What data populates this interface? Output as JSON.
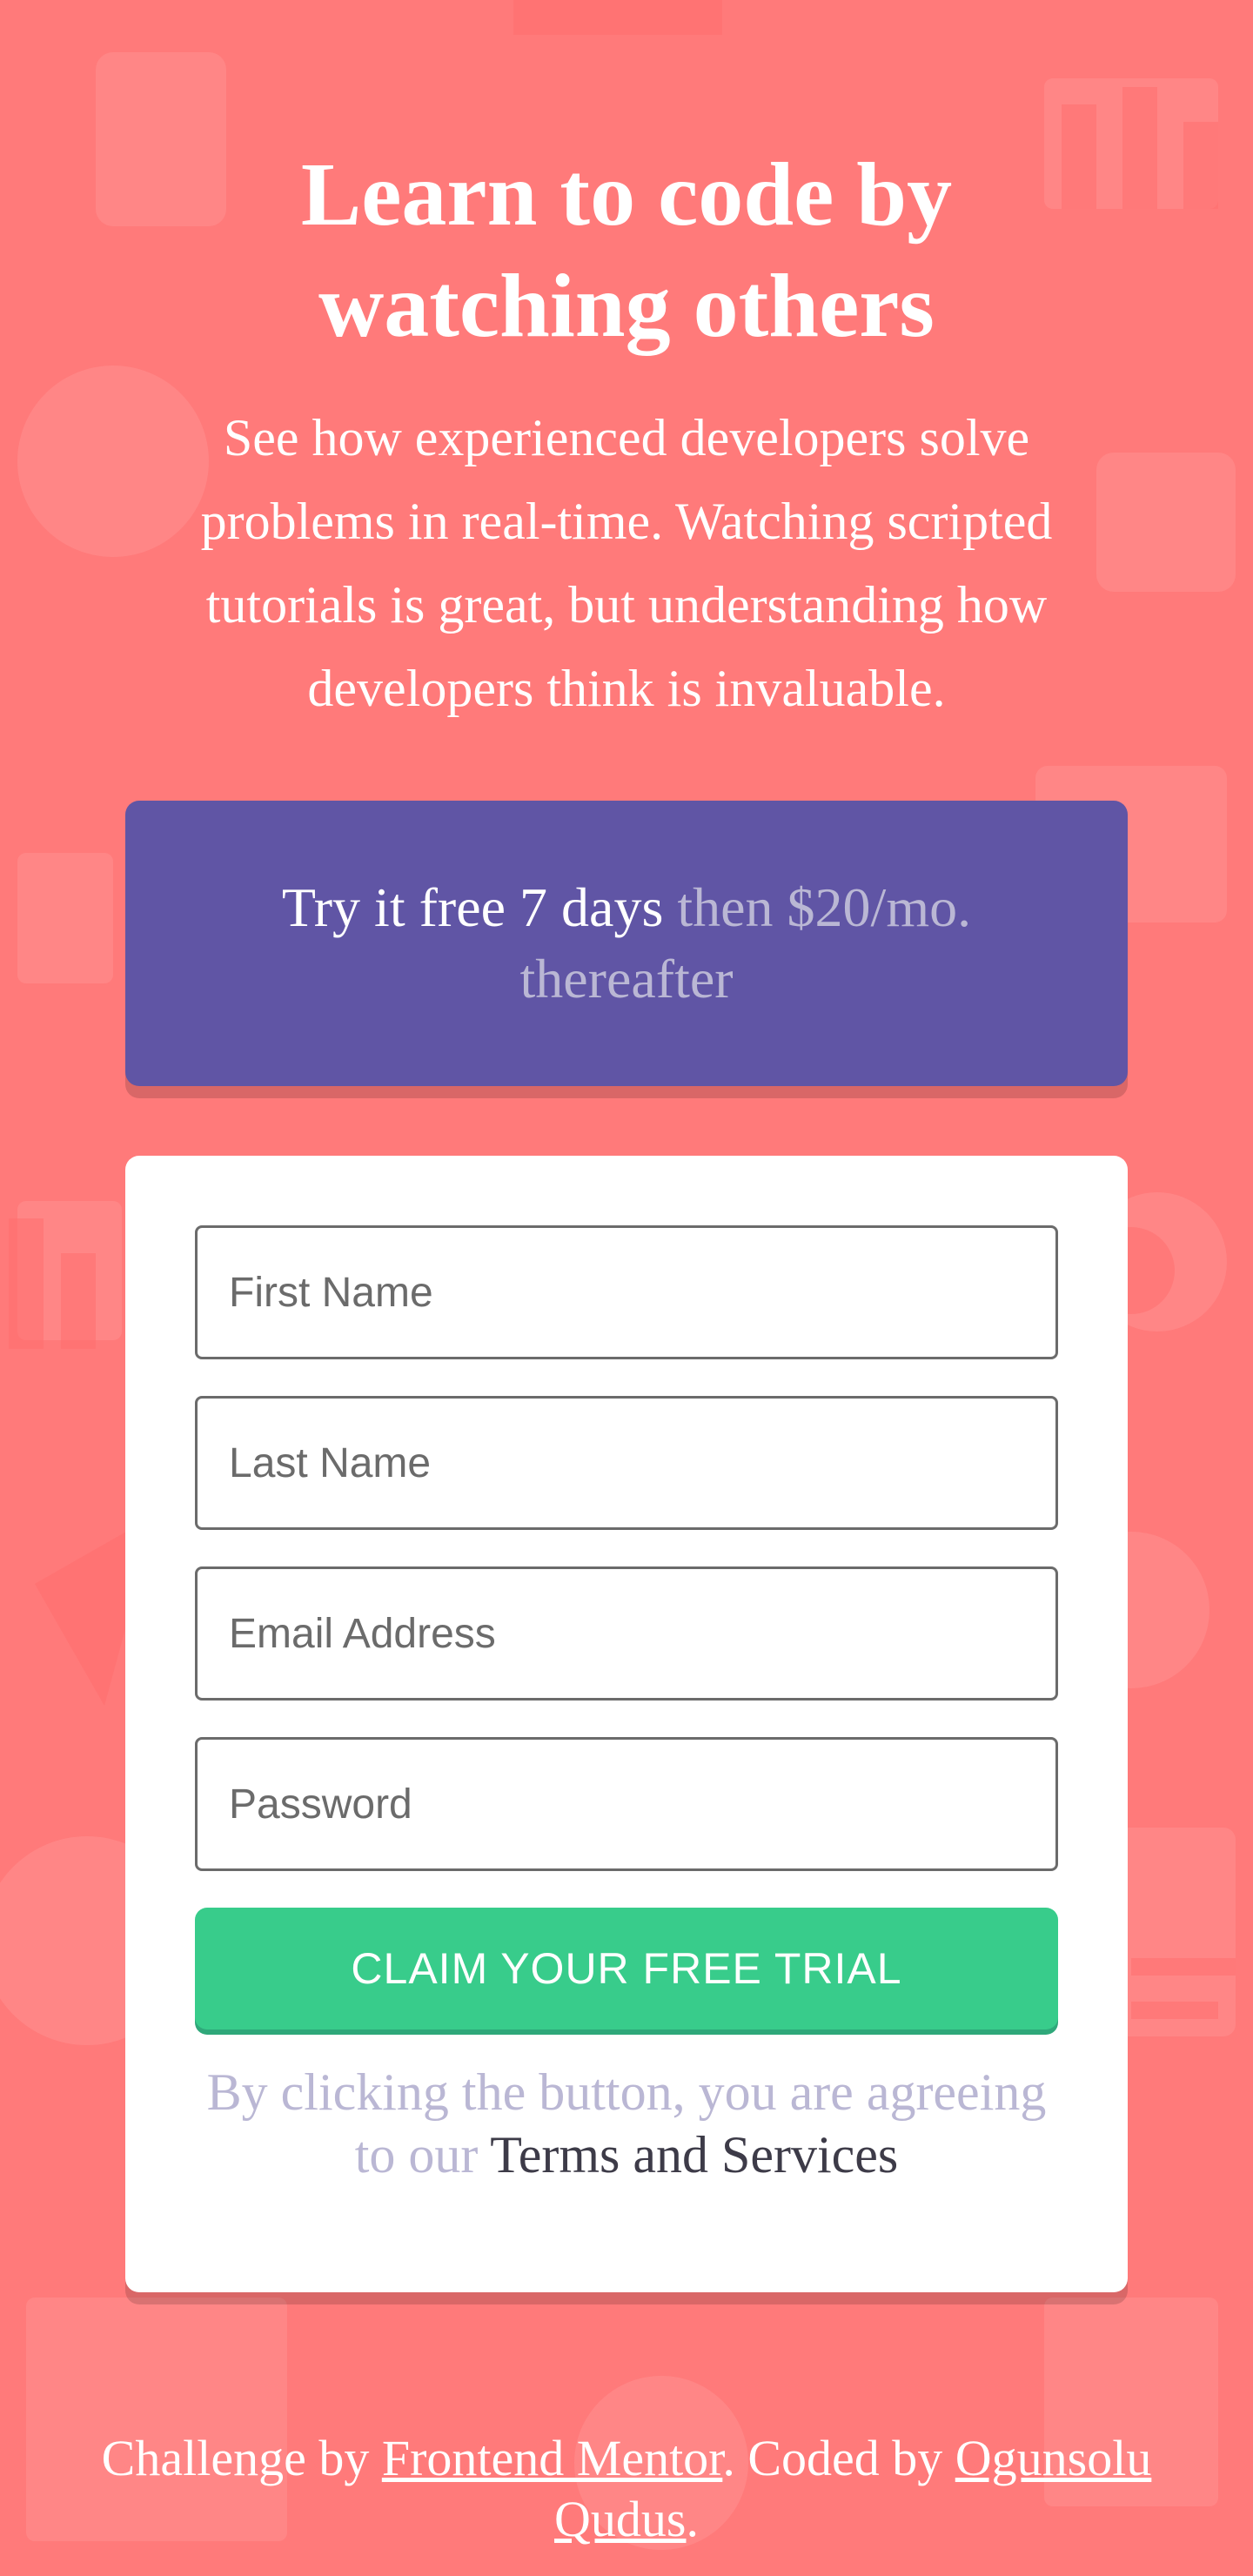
{
  "hero": {
    "title": "Learn to code by watching others",
    "description": "See how experienced developers solve problems in real-time. Watching scripted tutorials is great, but understanding how developers think is invaluable."
  },
  "promo": {
    "strong_text": "Try it free 7 days",
    "muted_text": "then $20/mo. thereafter"
  },
  "form": {
    "first_name": {
      "placeholder": "First Name",
      "value": ""
    },
    "last_name": {
      "placeholder": "Last Name",
      "value": ""
    },
    "email": {
      "placeholder": "Email Address",
      "value": ""
    },
    "password": {
      "placeholder": "Password",
      "value": ""
    },
    "submit_label": "CLAIM YOUR FREE TRIAL",
    "terms_prefix": "By clicking the button, you are agreeing to our",
    "terms_link": "Terms and Services"
  },
  "footer": {
    "challenge_prefix": "Challenge by",
    "challenge_link": "Frontend Mentor",
    "coded_prefix": ". Coded by",
    "coded_link": "Ogunsolu Qudus",
    "suffix": "."
  },
  "colors": {
    "background": "#ff7a7a",
    "promo": "#6055a5",
    "accent_green": "#38cc8b",
    "muted_text": "#bab7d4",
    "dark_text": "#3d3b48"
  }
}
